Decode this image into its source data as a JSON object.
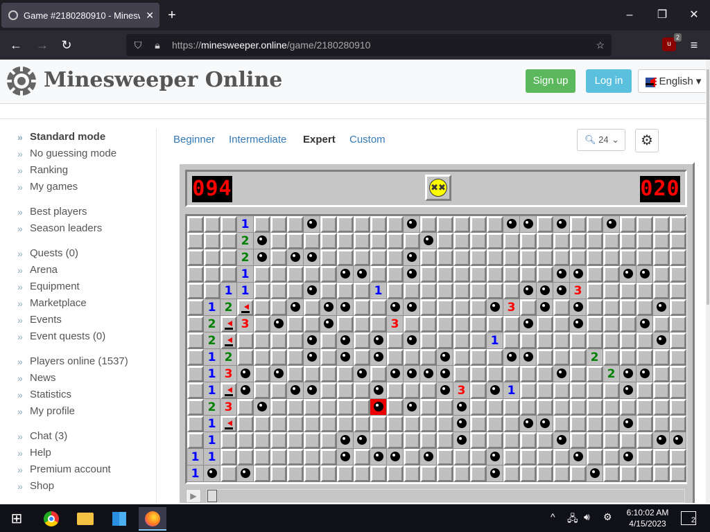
{
  "browser": {
    "tab_title": "Game #2180280910 - Minesweeper Online",
    "url_scheme": "https://",
    "url_host": "minesweeper.online",
    "url_path": "/game/2180280910",
    "extension_badge": "2"
  },
  "site": {
    "name": "Minesweeper Online",
    "signup": "Sign up",
    "login": "Log in",
    "language": "English"
  },
  "sidebar": [
    [
      "Standard mode",
      "No guessing mode",
      "Ranking",
      "My games"
    ],
    [
      "Best players",
      "Season leaders"
    ],
    [
      "Quests (0)",
      "Arena",
      "Equipment",
      "Marketplace",
      "Events",
      "Event quests (0)"
    ],
    [
      "Players online (1537)",
      "News",
      "Statistics",
      "My profile"
    ],
    [
      "Chat (3)",
      "Help",
      "Premium account",
      "Shop"
    ]
  ],
  "levels": {
    "beginner": "Beginner",
    "intermediate": "Intermediate",
    "expert": "Expert",
    "custom": "Custom"
  },
  "zoom": "24",
  "game": {
    "mines_left": "094",
    "timer": "020",
    "rows": [
      "HHH1HHHMHHHHHMHHHHHMMHMHHMHHHHHH",
      "HHH2MHHHHHHHHHMHHHHHHHHHHHHHHHHH",
      "HHH2MHMMHHHHHMHHHHHHHHHHHHHHHHMH",
      "HHH1HHHHHMMHHMHHHHHHHHMMHHMMHHMH",
      "HH11HHHMHHH1HHHHHHHHMMM3HHHHHHHH",
      "H12FHHMHMMHHMMHHHHM3HMHMHHHHMHHH",
      "H2F3HMHHMHHH3HHHHHHHMHHMHHHMHHHH",
      "H2FHHHHMHMHMHMHHHH1HHHHHHHHHMHHH",
      "H12HHHHMHMHMHHHMHHHMMHHH2HHHHHMH",
      "H13MHMHHHHMHMMMMHHHHHHMHH2MMHHMH",
      "H1FMHHMMHHHMHHHM3HM1HHHHHHMHHHHH",
      "H23HMHHHHHHXHMHHMHHHHHHHHHHHHHHH",
      "H1FHHHHHHHHHHHHHMHHHMMHHHHMHHHHH",
      "H1HHHHHHHMMHHHHHMHHHHHMHHHHHMMHH",
      "11HHHHHHHMHMMHMHHHMHHHHMHHMHHHHH",
      "1MHMHHHHHHHHHHHHHHMHHHHHMHHHHHHH"
    ]
  },
  "taskbar": {
    "time": "6:10:02 AM",
    "date": "4/15/2023",
    "notifications": "2"
  }
}
